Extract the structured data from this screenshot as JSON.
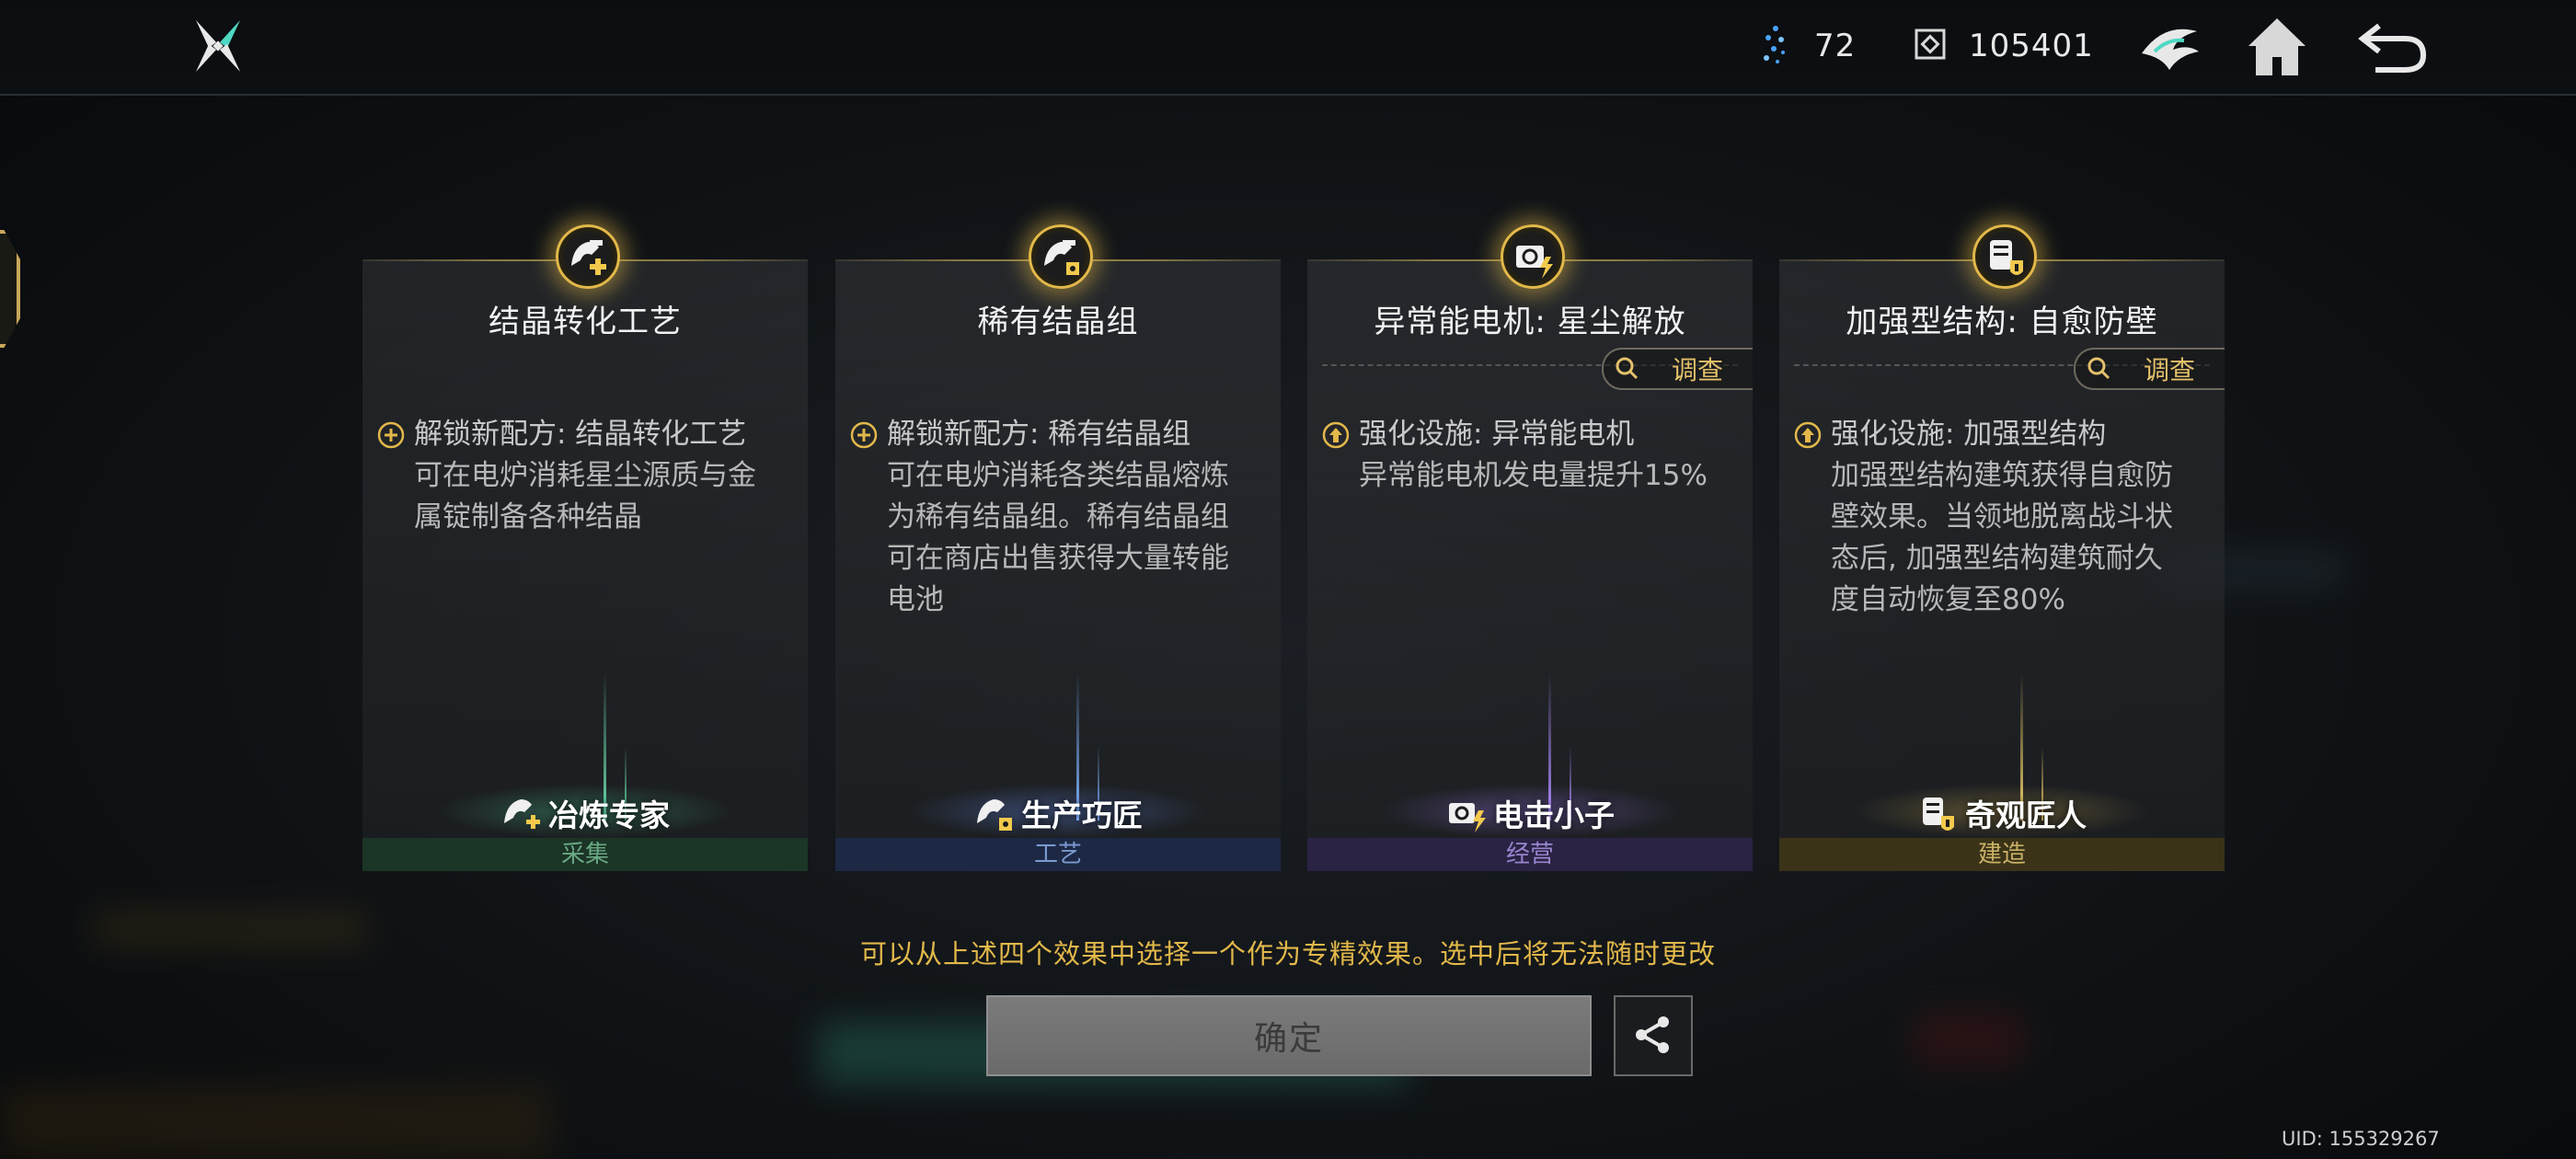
{
  "topbar": {
    "resources": [
      {
        "icon": "crystal-icon",
        "value": "72"
      },
      {
        "icon": "chip-icon",
        "value": "105401"
      }
    ]
  },
  "cards": [
    {
      "title": "结晶转化工艺",
      "has_investigate": false,
      "effect_icon": "plus-circle-icon",
      "effect_head": "解锁新配方: 结晶转化工艺",
      "effect_body": [
        "可在电炉消耗星尘源质与金",
        "属锭制备各种结晶"
      ],
      "specialist": "冶炼专家",
      "category": "采集"
    },
    {
      "title": "稀有结晶组",
      "has_investigate": false,
      "effect_icon": "plus-circle-icon",
      "effect_head": "解锁新配方: 稀有结晶组",
      "effect_body": [
        "可在电炉消耗各类结晶熔炼",
        "为稀有结晶组。稀有结晶组",
        "可在商店出售获得大量转能",
        "电池"
      ],
      "specialist": "生产巧匠",
      "category": "工艺"
    },
    {
      "title": "异常能电机: 星尘解放",
      "has_investigate": true,
      "investigate_label": "调查",
      "effect_icon": "upgrade-arrow-icon",
      "effect_head": "强化设施: 异常能电机",
      "effect_body": [
        "异常能电机发电量提升15%"
      ],
      "specialist": "电击小子",
      "category": "经营"
    },
    {
      "title": "加强型结构: 自愈防壁",
      "has_investigate": true,
      "investigate_label": "调查",
      "effect_icon": "upgrade-arrow-icon",
      "effect_head": "强化设施: 加强型结构",
      "effect_body": [
        "加强型结构建筑获得自愈防",
        "壁效果。当领地脱离战斗状",
        "态后, 加强型结构建筑耐久",
        "度自动恢复至80%"
      ],
      "specialist": "奇观匠人",
      "category": "建造"
    }
  ],
  "hint": "可以从上述四个效果中选择一个作为专精效果。选中后将无法随时更改",
  "confirm_label": "确定",
  "uid": "UID: 155329267",
  "colors": {
    "gold": "#e2b84a",
    "gather": "#6ee0b0",
    "craft": "#7fb5ff",
    "business": "#b08cff",
    "build": "#f0d06a"
  }
}
